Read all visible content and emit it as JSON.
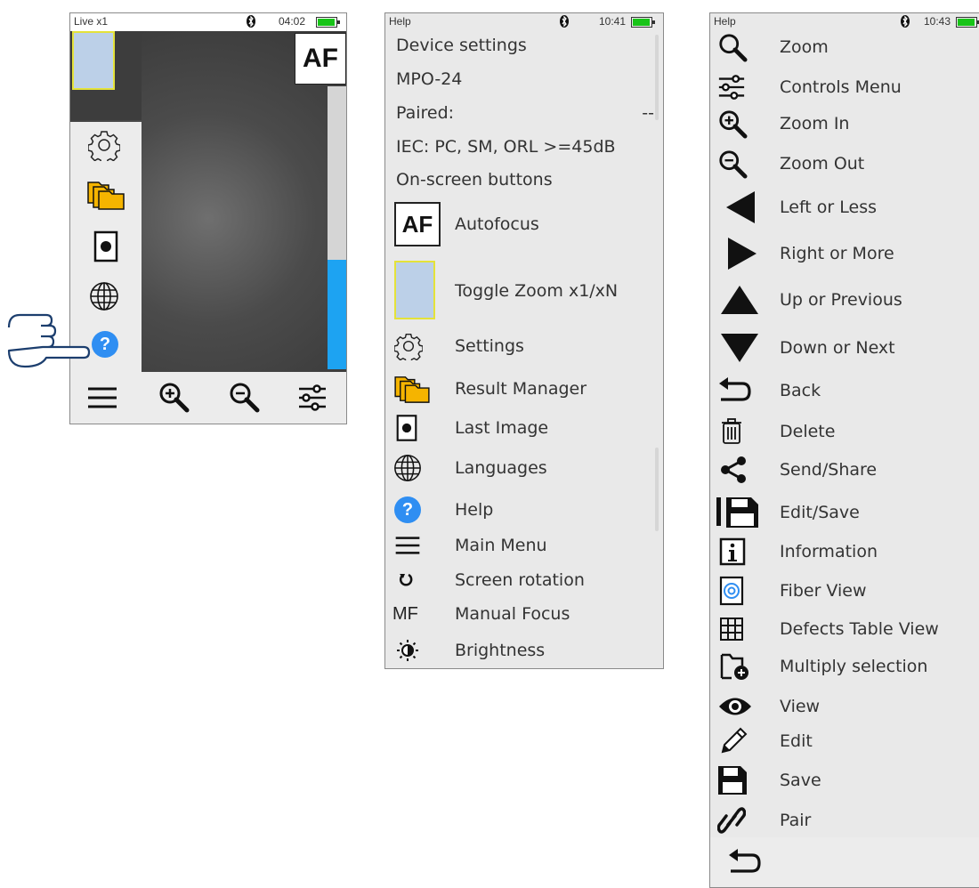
{
  "screen1": {
    "status": {
      "title": "Live x1",
      "time": "04:02",
      "bt_icon": "bluetooth-icon",
      "battery_level": 0.85
    },
    "af_label": "AF",
    "side_icons": [
      "gear-icon",
      "folder-icon",
      "last-image-icon",
      "globe-icon",
      "help-icon"
    ],
    "help_glyph": "?",
    "bottom_icons": [
      "menu-icon",
      "zoom-in-icon",
      "zoom-out-icon",
      "controls-icon"
    ],
    "focus_level": 0.35
  },
  "screen2": {
    "status": {
      "title": "Help",
      "time": "10:41",
      "bt_icon": "bluetooth-icon",
      "battery_level": 0.85
    },
    "info_rows": [
      "Device settings",
      "MPO-24",
      "Paired:",
      "IEC: PC, SM, ORL >=45dB",
      "On-screen buttons"
    ],
    "paired_value": "--",
    "af_label": "AF",
    "mf_label": "MF",
    "help_glyph": "?",
    "items": [
      {
        "icon": "af-icon",
        "label": "Autofocus"
      },
      {
        "icon": "zoom-thumb-icon",
        "label": "Toggle Zoom x1/xN"
      },
      {
        "icon": "gear-icon",
        "label": "Settings"
      },
      {
        "icon": "folder-icon",
        "label": "Result Manager"
      },
      {
        "icon": "last-image-icon",
        "label": "Last Image"
      },
      {
        "icon": "globe-icon",
        "label": "Languages"
      },
      {
        "icon": "help-icon",
        "label": "Help"
      },
      {
        "icon": "menu-icon",
        "label": "Main Menu"
      },
      {
        "icon": "rotate-icon",
        "label": "Screen rotation"
      },
      {
        "icon": "mf-icon",
        "label": "Manual Focus"
      },
      {
        "icon": "brightness-icon",
        "label": "Brightness"
      }
    ]
  },
  "screen3": {
    "status": {
      "title": "Help",
      "time": "10:43",
      "bt_icon": "bluetooth-icon",
      "battery_level": 0.85
    },
    "items": [
      {
        "icon": "search-icon",
        "label": "Zoom"
      },
      {
        "icon": "controls-icon",
        "label": "Controls Menu"
      },
      {
        "icon": "zoom-in-icon",
        "label": "Zoom In"
      },
      {
        "icon": "zoom-out-icon",
        "label": "Zoom Out"
      },
      {
        "icon": "arrow-left-icon",
        "label": "Left or Less"
      },
      {
        "icon": "arrow-right-icon",
        "label": "Right or More"
      },
      {
        "icon": "arrow-up-icon",
        "label": "Up or Previous"
      },
      {
        "icon": "arrow-down-icon",
        "label": "Down or Next"
      },
      {
        "icon": "back-icon",
        "label": "Back"
      },
      {
        "icon": "trash-icon",
        "label": "Delete"
      },
      {
        "icon": "share-icon",
        "label": "Send/Share"
      },
      {
        "icon": "edit-save-icon",
        "label": "Edit/Save"
      },
      {
        "icon": "info-icon",
        "label": "Information"
      },
      {
        "icon": "fiber-view-icon",
        "label": "Fiber View"
      },
      {
        "icon": "table-icon",
        "label": "Defects Table View"
      },
      {
        "icon": "folder-add-icon",
        "label": "Multiply selection"
      },
      {
        "icon": "eye-icon",
        "label": "View"
      },
      {
        "icon": "pencil-icon",
        "label": "Edit"
      },
      {
        "icon": "save-icon",
        "label": "Save"
      },
      {
        "icon": "link-icon",
        "label": "Pair"
      }
    ],
    "footer_icon": "back-icon"
  },
  "colors": {
    "accent_blue": "#2f8ef2",
    "folder_yellow": "#f5b400",
    "battery_green": "#18c418",
    "focus_bar": "#1da3f2"
  }
}
